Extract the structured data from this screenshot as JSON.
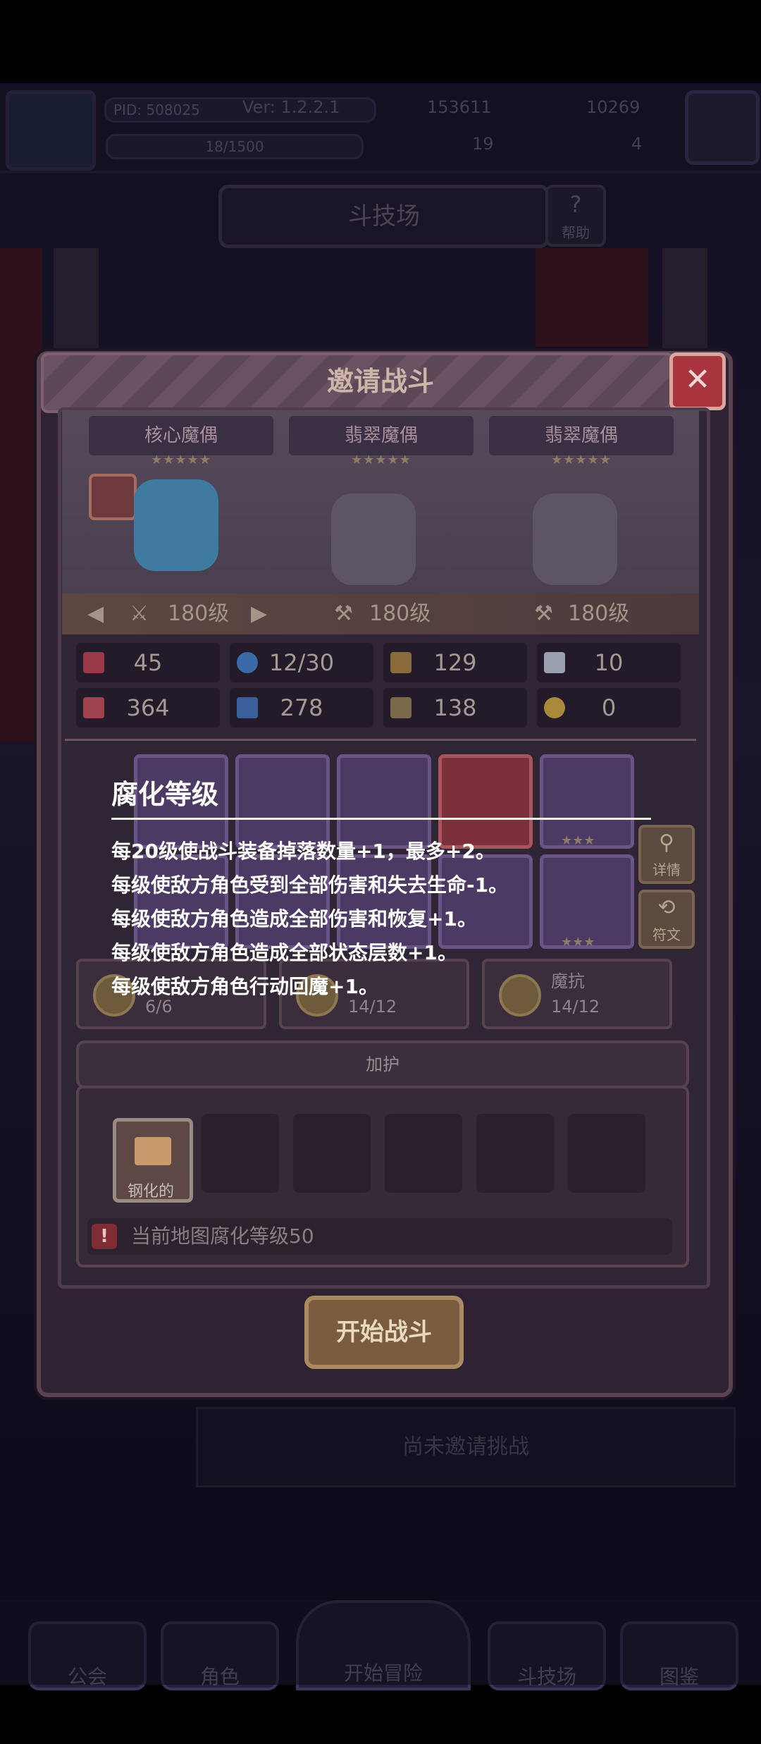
{
  "header": {
    "pid": "PID: 508025",
    "version": "Ver: 1.2.2.1",
    "gold": "153611",
    "gems": "10269",
    "stamina": "18/1500",
    "clovers": "19",
    "keys": "4"
  },
  "page": {
    "title": "斗技场",
    "help_label": "帮助"
  },
  "modal": {
    "title": "邀请战斗",
    "close_label": "✕",
    "heroes": [
      {
        "name": "核心魔偶",
        "stars": "★★★★★",
        "level": "180级"
      },
      {
        "name": "翡翠魔偶",
        "stars": "★★★★★",
        "level": "180级"
      },
      {
        "name": "翡翠魔偶",
        "stars": "★★★★★",
        "level": "180级"
      }
    ],
    "stats": [
      {
        "icon": "heart-icon",
        "value": "45"
      },
      {
        "icon": "mana-drop-icon",
        "value": "12/30"
      },
      {
        "icon": "shield-icon",
        "value": "129"
      },
      {
        "icon": "wing-icon",
        "value": "10"
      },
      {
        "icon": "attack-icon",
        "value": "364"
      },
      {
        "icon": "spellbook-icon",
        "value": "278"
      },
      {
        "icon": "armor-icon",
        "value": "138"
      },
      {
        "icon": "magnet-icon",
        "value": "0"
      }
    ],
    "side_buttons": {
      "details": "详情",
      "runes": "符文"
    },
    "equip_stars": "★★★",
    "traits": [
      {
        "label": "",
        "value": "6/6"
      },
      {
        "label": "",
        "value": "14/12"
      },
      {
        "label": "魔抗",
        "value": "14/12"
      }
    ],
    "guard": {
      "title": "加护",
      "item_label": "钢化的",
      "warning": "当前地图腐化等级50"
    },
    "start_button": "开始战斗"
  },
  "background": {
    "no_challenge": "尚未邀请挑战"
  },
  "nav": {
    "guild": "公会",
    "character": "角色",
    "adventure": "开始冒险",
    "arena": "斗技场",
    "codex": "图鉴"
  },
  "tooltip": {
    "title": "腐化等级",
    "lines": [
      "每20级使战斗装备掉落数量+1，最多+2。",
      "每级使敌方角色受到全部伤害和失去生命-1。",
      "每级使敌方角色造成全部伤害和恢复+1。",
      "每级使敌方角色造成全部状态层数+1。",
      "每级使敌方角色行动回魔+1。"
    ]
  },
  "colors": {
    "modal_bg": "#2e2233",
    "close_red": "#a8343e",
    "tooltip_text": "#ffffff",
    "start_button": "#7a5c3f"
  }
}
